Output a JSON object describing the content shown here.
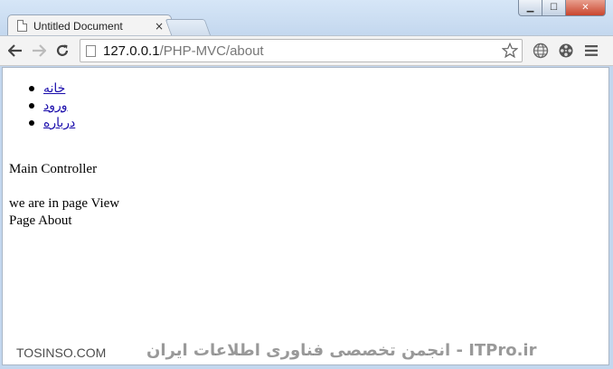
{
  "browser": {
    "tab_title": "Untitled Document",
    "tab_close": "×",
    "url_host": "127.0.0.1",
    "url_path": "/PHP-MVC/about",
    "window_controls": {
      "minimize": "▁",
      "maximize": "☐",
      "close": "✕"
    }
  },
  "page": {
    "nav": [
      {
        "label": "خانه"
      },
      {
        "label": "ورود"
      },
      {
        "label": "درباره"
      }
    ],
    "controller_text": "Main Controller",
    "view_text": "we are in page View",
    "page_text": "Page About"
  },
  "watermark": {
    "left": "TOSINSO.COM",
    "right": "ITPro.ir - انجمن تخصصی فناوری اطلاعات ایران"
  },
  "colors": {
    "link": "#1a0dab",
    "close_button": "#c9452d"
  }
}
